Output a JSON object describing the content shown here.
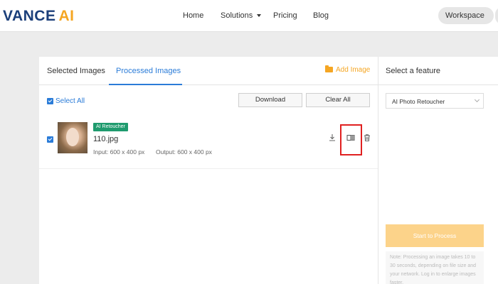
{
  "header": {
    "logo_primary": "VANCE",
    "logo_accent": "AI",
    "nav": [
      "Home",
      "Solutions",
      "Pricing",
      "Blog"
    ],
    "workspace_label": "Workspace"
  },
  "tabs": {
    "selected": "Selected Images",
    "processed": "Processed Images",
    "active": "Processed Images"
  },
  "toolbar": {
    "add_image": "Add Image",
    "select_all": "Select All",
    "download": "Download",
    "clear_all": "Clear All"
  },
  "image_row": {
    "badge": "AI Retoucher",
    "filename": "110.jpg",
    "input": "Input: 600 x 400 px",
    "output": "Output: 600 x 400 px",
    "actions": [
      "download-icon",
      "compare-icon",
      "trash-icon"
    ]
  },
  "panel": {
    "title": "Select a feature",
    "feature_selected": "AI Photo Retoucher",
    "start_button": "Start to Process",
    "note": "Note: Processing an image takes 10 to 30 seconds, depending on file size and your network. Log in to enlarge images faster."
  },
  "colors": {
    "brand_blue": "#1b3f7a",
    "brand_orange": "#f5a623",
    "accent_blue": "#2b7cd8",
    "badge_green": "#1f9b6e",
    "highlight_red": "#e02020"
  }
}
